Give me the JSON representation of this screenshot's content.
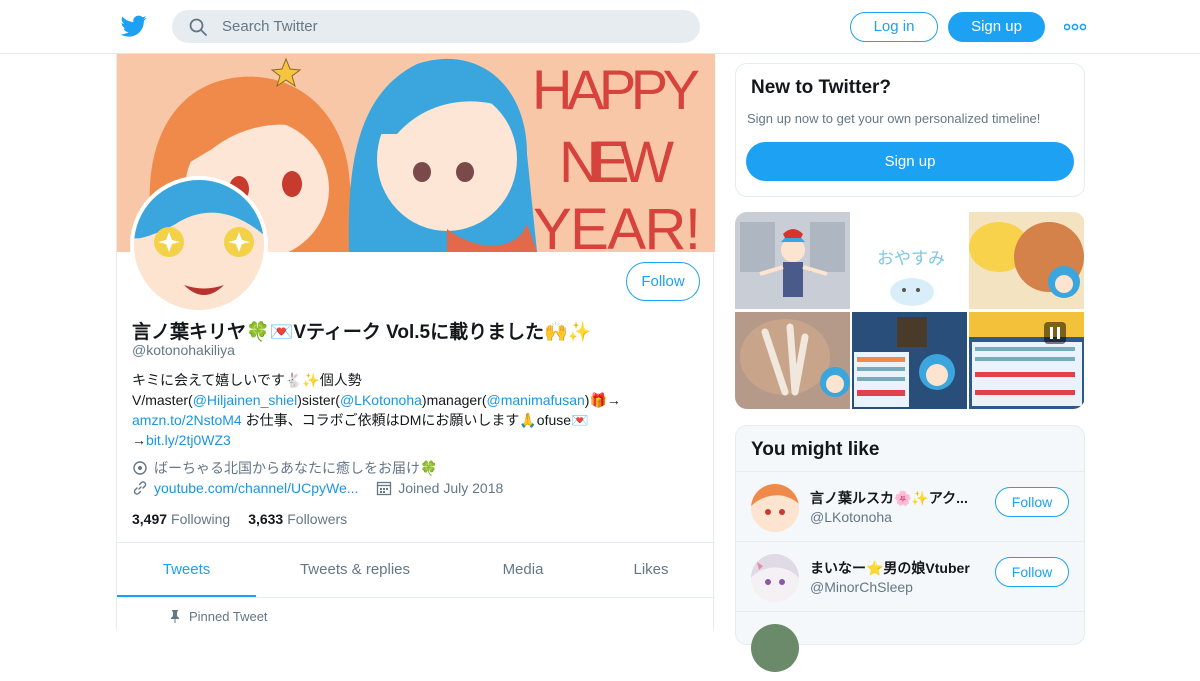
{
  "header": {
    "search_placeholder": "Search Twitter",
    "login_label": "Log in",
    "signup_label": "Sign up"
  },
  "profile": {
    "banner_text": [
      "HAPPY",
      "NEW",
      "YEAR!"
    ],
    "follow_label": "Follow",
    "display_name": "言ノ葉キリヤ🍀💌Vティーク Vol.5に載りました🙌✨",
    "handle": "@kotonohakiliya",
    "bio": {
      "line1": "キミに会えて嬉しいです🐇✨個人勢",
      "line2_a": "V/master(",
      "link_master": "@Hiljainen_shiel",
      "line2_b": ")sister(",
      "link_sister": "@LKotonoha",
      "line2_c": ")manager(",
      "link_manager": "@manimafusan",
      "line2_d": ")🎁→",
      "link_amzn": "amzn.to/2NstoM4",
      "line3_b": " お仕事、コラボご依頼はDMにお願いします🙏ofuse💌",
      "line4_a": "→",
      "link_bitly": "bit.ly/2tj0WZ3"
    },
    "location": "ばーちゃる北国からあなたに癒しをお届け🍀",
    "website": "youtube.com/channel/UCpyWe...",
    "joined": "Joined July 2018",
    "following_count": "3,497",
    "following_label": "Following",
    "followers_count": "3,633",
    "followers_label": "Followers"
  },
  "tabs": [
    {
      "label": "Tweets",
      "active": true
    },
    {
      "label": "Tweets & replies",
      "active": false
    },
    {
      "label": "Media",
      "active": false
    },
    {
      "label": "Likes",
      "active": false
    }
  ],
  "pinned_label": "Pinned Tweet",
  "new_to_twitter": {
    "title": "New to Twitter?",
    "subtitle": "Sign up now to get your own personalized timeline!",
    "button": "Sign up"
  },
  "media_grid": {
    "oyasumi_text": "おやすみ"
  },
  "you_might_like": {
    "title": "You might like",
    "accounts": [
      {
        "name": "言ノ葉ルスカ🌸✨アク...",
        "handle": "@LKotonoha",
        "follow": "Follow"
      },
      {
        "name": "まいなー⭐男の娘Vtuber",
        "handle": "@MinorChSleep",
        "follow": "Follow"
      }
    ]
  },
  "colors": {
    "accent": "#1da1f2",
    "link": "#1b95e0",
    "muted": "#657786",
    "banner_bg": "#f8c7a7",
    "banner_text": "#d6423c"
  }
}
